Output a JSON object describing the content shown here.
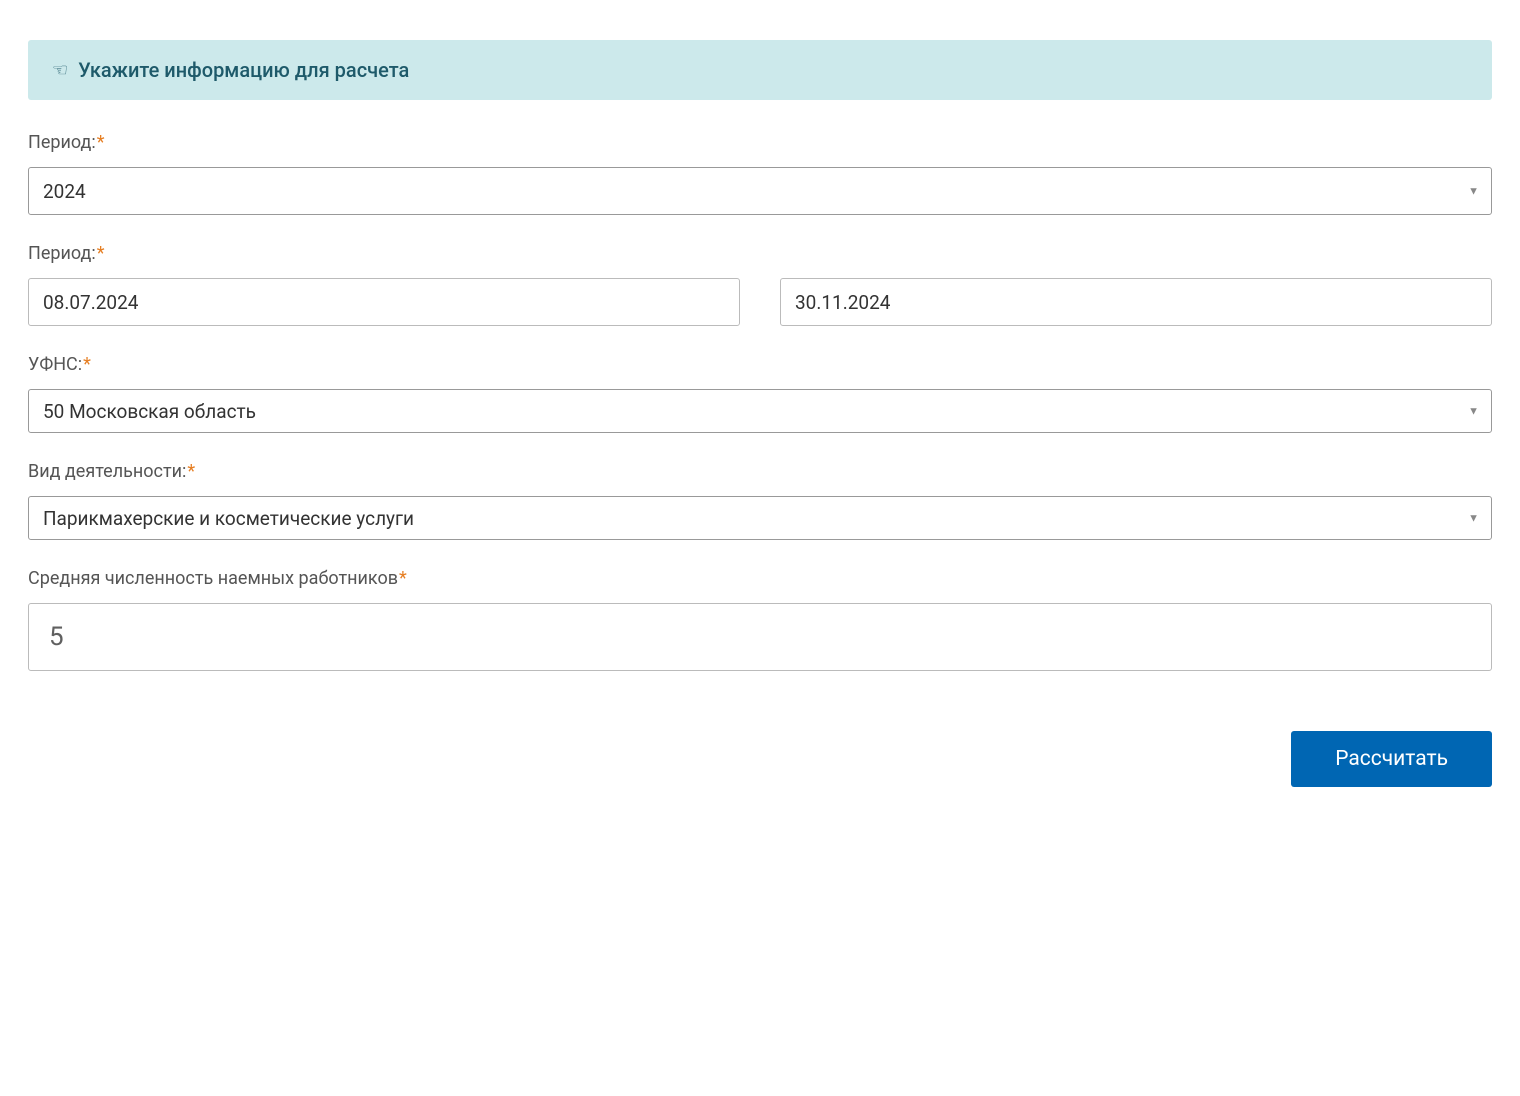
{
  "banner": {
    "text": "Укажите информацию для расчета"
  },
  "fields": {
    "period_year": {
      "label": "Период:",
      "value": "2024"
    },
    "period_dates": {
      "label": "Период:",
      "from": "08.07.2024",
      "to": "30.11.2024"
    },
    "ufns": {
      "label": "УФНС:",
      "value": "50 Московская область"
    },
    "activity": {
      "label": "Вид деятельности:",
      "value": "Парикмахерские и косметические услуги"
    },
    "employees": {
      "label": "Средняя численность наемных работников",
      "value": "5"
    }
  },
  "button": {
    "calculate": "Рассчитать"
  }
}
